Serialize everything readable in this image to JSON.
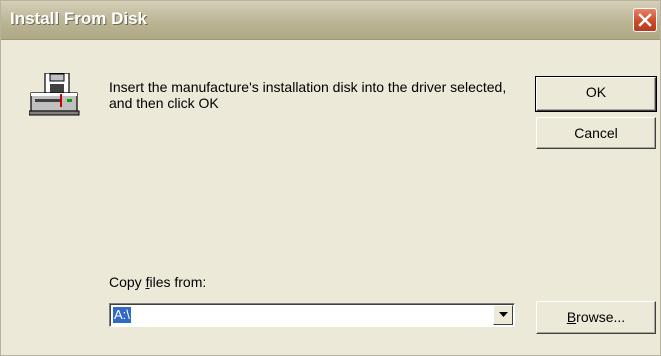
{
  "window": {
    "title": "Install From Disk",
    "close_icon": "close-icon"
  },
  "message": "Insert the manufacture's installation disk into the driver selected, and then click OK",
  "icons": {
    "disk": "floppy-drive-icon",
    "dropdown": "chevron-down-icon"
  },
  "buttons": {
    "ok_label": "OK",
    "cancel_label": "Cancel",
    "browse_prefix": "",
    "browse_mnemonic": "B",
    "browse_rest": "rowse..."
  },
  "copy_files": {
    "label_prefix": "Copy ",
    "label_mnemonic": "f",
    "label_rest": "iles from:",
    "value": "A:\\"
  },
  "colors": {
    "titlebar": "#c6c1a6",
    "close": "#cc4b2c",
    "selection": "#316ac5",
    "face": "#ece9d8"
  }
}
